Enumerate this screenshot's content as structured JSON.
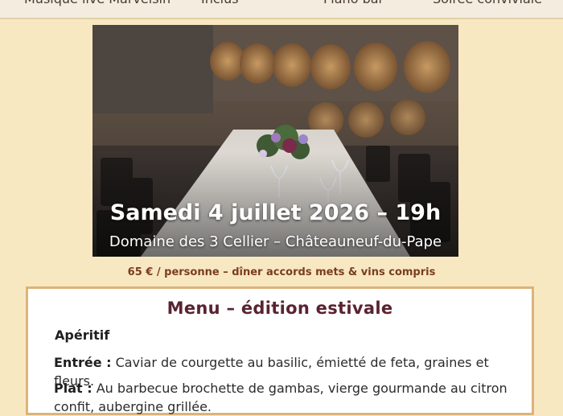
{
  "top_features": [
    "Musique live Marvelsin",
    "Inclus",
    "Piano bar",
    "Soirée conviviale"
  ],
  "event": {
    "date": "Samedi 4 juillet 2026 – 19h",
    "venue": "Domaine des 3 Cellier – Châteauneuf-du-Pape"
  },
  "price": "65 € / personne – dîner accords mets & vins compris",
  "menu": {
    "title": "Menu – édition estivale",
    "aperitif_label": "Apéritif",
    "entree_label": "Entrée :",
    "entree_text": " Caviar de courgette au basilic, émietté de feta, graines et fleurs.",
    "plat_label": "Plat :",
    "plat_text": " Au barbecue brochette de gambas, vierge gourmande au citron confit, aubergine grillée."
  },
  "colors": {
    "background": "#f8e8c2",
    "menu_title": "#5a2331",
    "price": "#7a3d22",
    "card_border": "#d9b47a"
  }
}
